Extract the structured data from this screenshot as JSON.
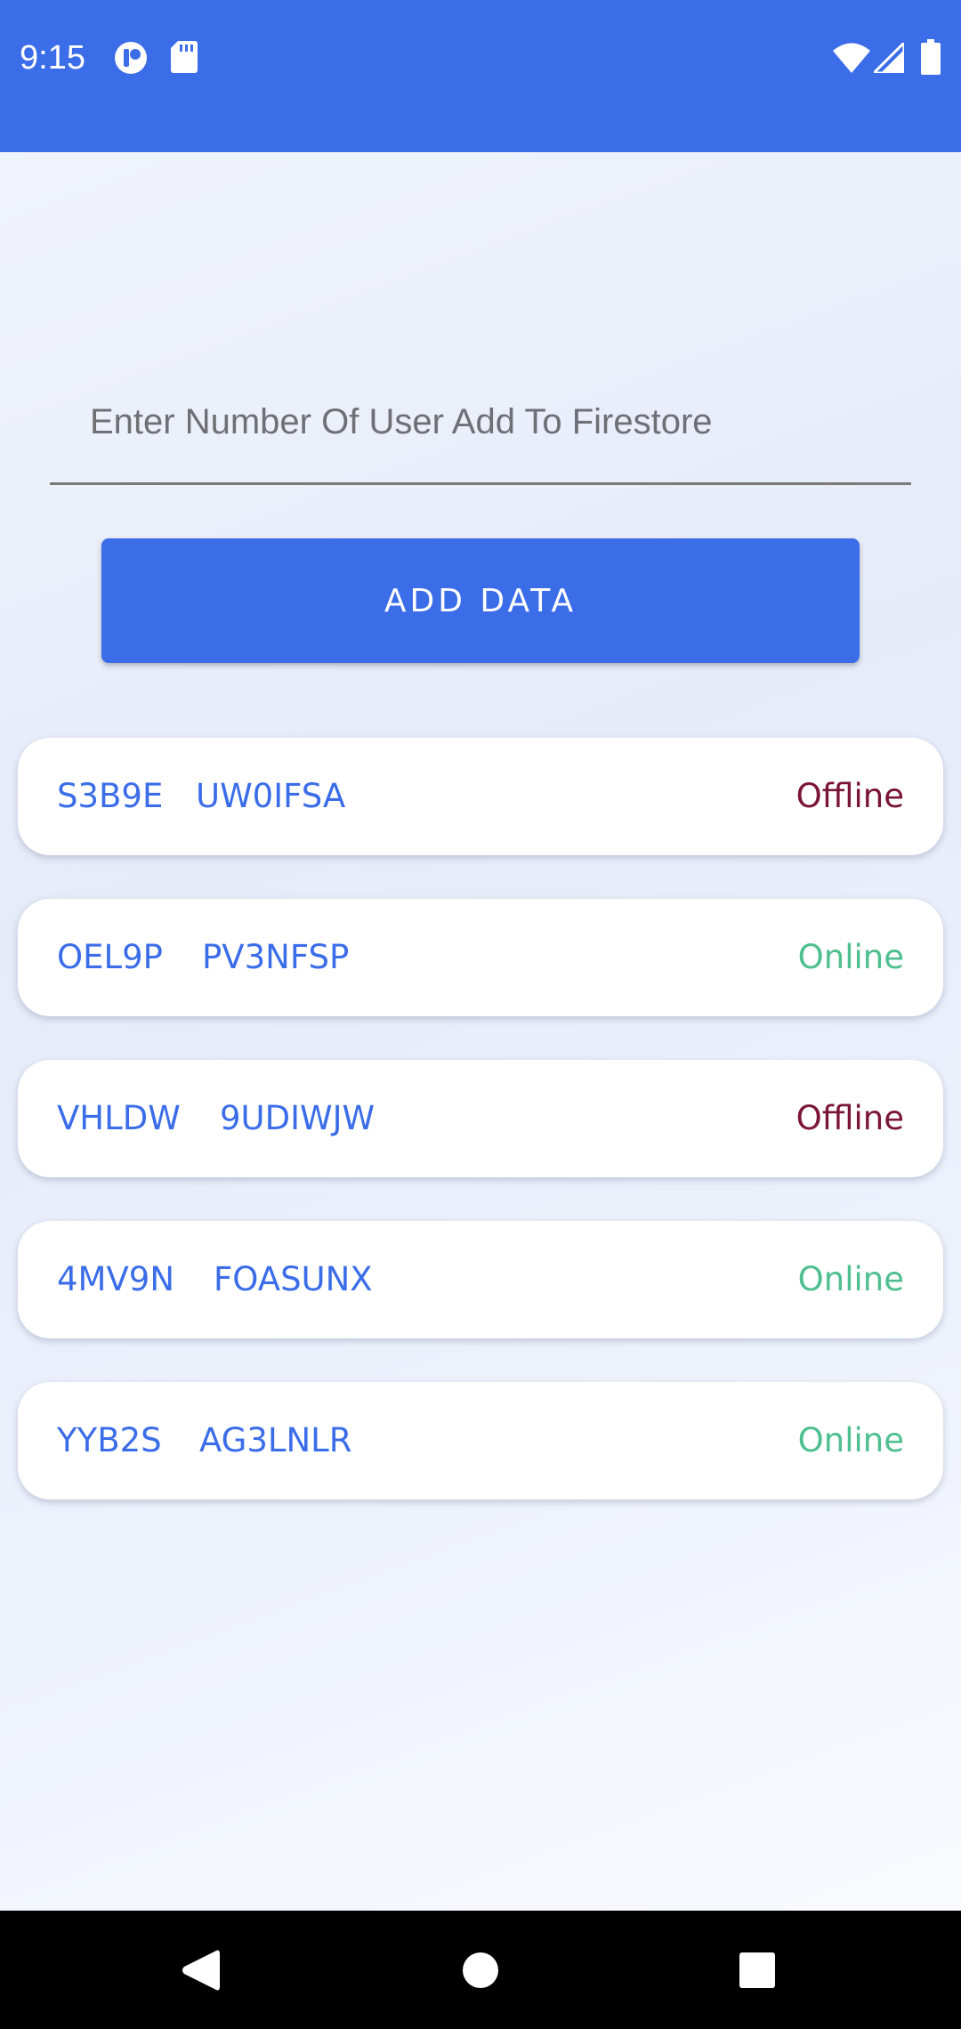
{
  "status_bar": {
    "time": "9:15",
    "background_color": "#3b6de9",
    "icons_left": [
      "notification-app-icon",
      "sd-card-icon"
    ],
    "icons_right": [
      "wifi-icon",
      "signal-icon",
      "battery-icon"
    ]
  },
  "form": {
    "input_placeholder": "Enter Number Of User Add To Firestore",
    "input_value": "",
    "add_button_label": "ADD DATA"
  },
  "users": [
    {
      "id": "S3B9E",
      "name": "UW0IFSA",
      "status": "Offline"
    },
    {
      "id": "OEL9P",
      "name": "PV3NFSP",
      "status": "Online"
    },
    {
      "id": "VHLDW",
      "name": "9UDIWJW",
      "status": "Offline"
    },
    {
      "id": "4MV9N",
      "name": "FOASUNX",
      "status": "Online"
    },
    {
      "id": "YYB2S",
      "name": "AG3LNLR",
      "status": "Online"
    }
  ],
  "colors": {
    "accent": "#3b6de9",
    "online": "#4fbf8f",
    "offline": "#7a1535"
  },
  "nav_bar": {
    "buttons": [
      "back-icon",
      "home-icon",
      "recents-icon"
    ]
  }
}
